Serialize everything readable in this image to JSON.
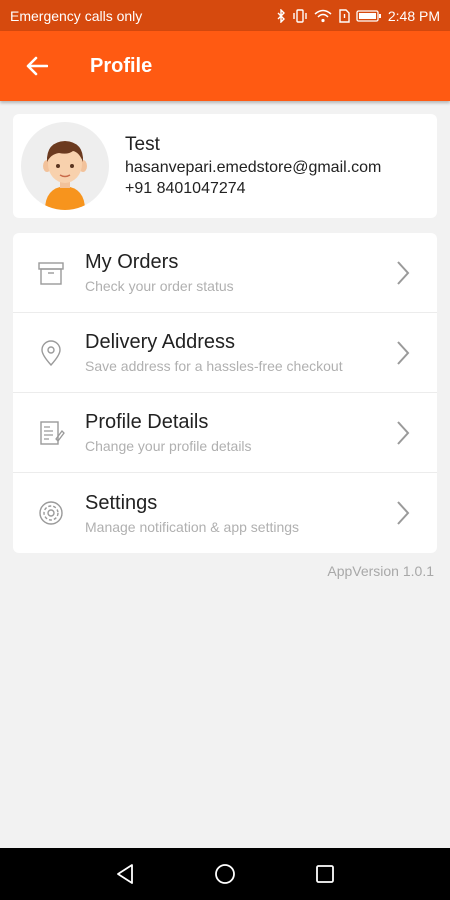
{
  "statusbar": {
    "carrier": "Emergency calls only",
    "time": "2:48 PM",
    "icons": [
      "bluetooth-icon",
      "vibrate-icon",
      "wifi-icon",
      "sim-icon",
      "battery-icon"
    ]
  },
  "appbar": {
    "title": "Profile",
    "back_icon": "arrow-left-icon"
  },
  "profile": {
    "name": "Test",
    "email": "hasanvepari.emedstore@gmail.com",
    "phone": "+91 8401047274",
    "avatar": "avatar-boy"
  },
  "menu": {
    "items": [
      {
        "title": "My Orders",
        "subtitle": "Check your order status",
        "icon": "box-icon"
      },
      {
        "title": "Delivery Address",
        "subtitle": "Save address for a hassles-free checkout",
        "icon": "location-pin-icon"
      },
      {
        "title": "Profile Details",
        "subtitle": "Change your profile details",
        "icon": "profile-doc-icon"
      },
      {
        "title": "Settings",
        "subtitle": "Manage notification & app settings",
        "icon": "gear-icon"
      }
    ]
  },
  "footer": {
    "app_version": "AppVersion 1.0.1"
  },
  "navbar": {
    "buttons": [
      "back-triangle-icon",
      "home-circle-icon",
      "recents-square-icon"
    ]
  },
  "colors": {
    "status_bar": "#d64a0e",
    "app_bar": "#ff5a12",
    "background": "#f2f2f2",
    "subtitle": "#b0b0b0"
  }
}
